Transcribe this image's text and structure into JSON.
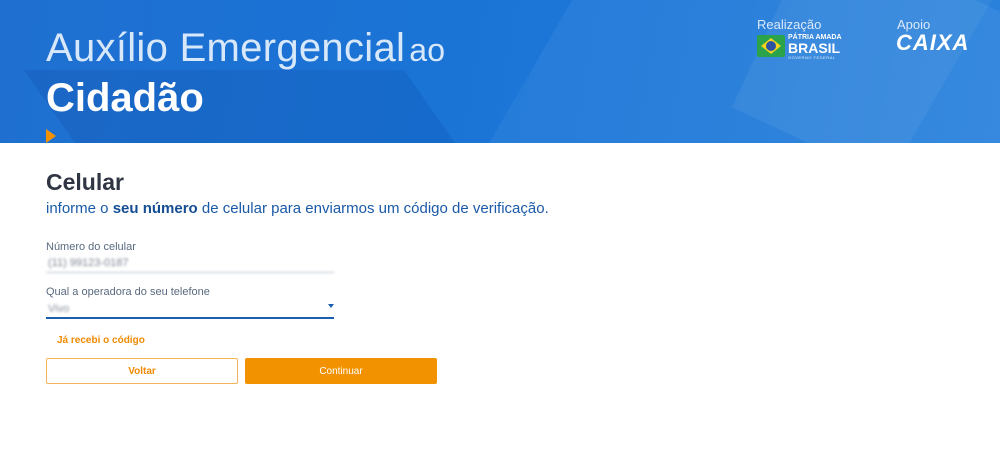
{
  "header": {
    "title_line1": "Auxílio Emergencial",
    "title_line1_suffix": "ao",
    "title_line2": "Cidadão",
    "realizacao_label": "Realização",
    "apoio_label": "Apoio",
    "gov_logo": {
      "line1": "PÁTRIA AMADA",
      "line2": "BRASIL",
      "line3": "GOVERNO FEDERAL"
    },
    "caixa_logo": "CAIXA"
  },
  "form": {
    "title": "Celular",
    "subtitle_pre": "informe o ",
    "subtitle_bold": "seu número",
    "subtitle_post": " de celular para enviarmos um código de verificação.",
    "phone_label": "Número do celular",
    "phone_value": "(11) 99123-0187",
    "operator_label": "Qual a operadora do seu telefone",
    "operator_value": "Vivo",
    "received_code_link": "Já recebi o código",
    "back_button": "Voltar",
    "continue_button": "Continuar"
  },
  "colors": {
    "header_blue": "#1a74d6",
    "accent_orange": "#f39200",
    "text_dark": "#2f3542",
    "text_blue": "#1a5aa8"
  }
}
